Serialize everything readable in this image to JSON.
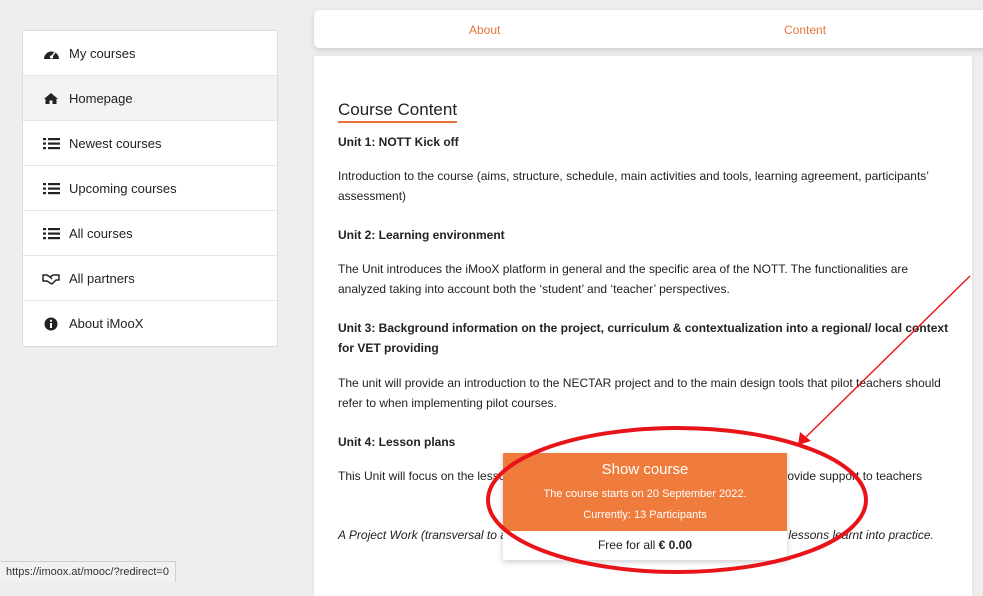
{
  "sidebar": {
    "items": [
      {
        "label": "My courses",
        "icon": "dashboard-icon"
      },
      {
        "label": "Homepage",
        "icon": "home-icon"
      },
      {
        "label": "Newest courses",
        "icon": "list-icon"
      },
      {
        "label": "Upcoming courses",
        "icon": "list-icon"
      },
      {
        "label": "All courses",
        "icon": "list-icon"
      },
      {
        "label": "All partners",
        "icon": "handshake-icon"
      },
      {
        "label": "About iMooX",
        "icon": "info-icon"
      }
    ],
    "active_index": 1
  },
  "tabs": {
    "about": "About",
    "content": "Content"
  },
  "main": {
    "title": "Course Content",
    "paragraphs": [
      "Unit 1: NOTT Kick off",
      "Introduction to the course (aims, structure, schedule, main activities and tools, learning agreement, participants’ assessment)",
      "Unit 2: Learning environment",
      "The Unit introduces the iMooX platform in general and the specific area of the NOTT. The functionalities are analyzed taking into account both the ‘student’ and ‘teacher’ perspectives.",
      "Unit 3: Background information on the project, curriculum & contextualization into a regional/ local context for VET providing",
      "The unit will provide an introduction to the NECTAR project and to the main design tools that pilot teachers should refer to when implementing pilot courses.",
      "Unit 4: Lesson plans",
      "This Unit will focus on the lesson plans developed by the NECTAR project and will provide support to teachers",
      "A Project Work (transversal to all units) will be assigned, with participants putting the lessons learnt into practice."
    ]
  },
  "popup": {
    "title": "Show course",
    "starts": "The course starts on 20 September 2022.",
    "participants": "Currently: 13 Participants",
    "free_prefix": "Free for all ",
    "price": "€ 0.00"
  },
  "status_url": "https://imoox.at/mooc/?redirect=0",
  "colors": {
    "accent": "#ef7c3c",
    "annotation": "#e8141a"
  }
}
